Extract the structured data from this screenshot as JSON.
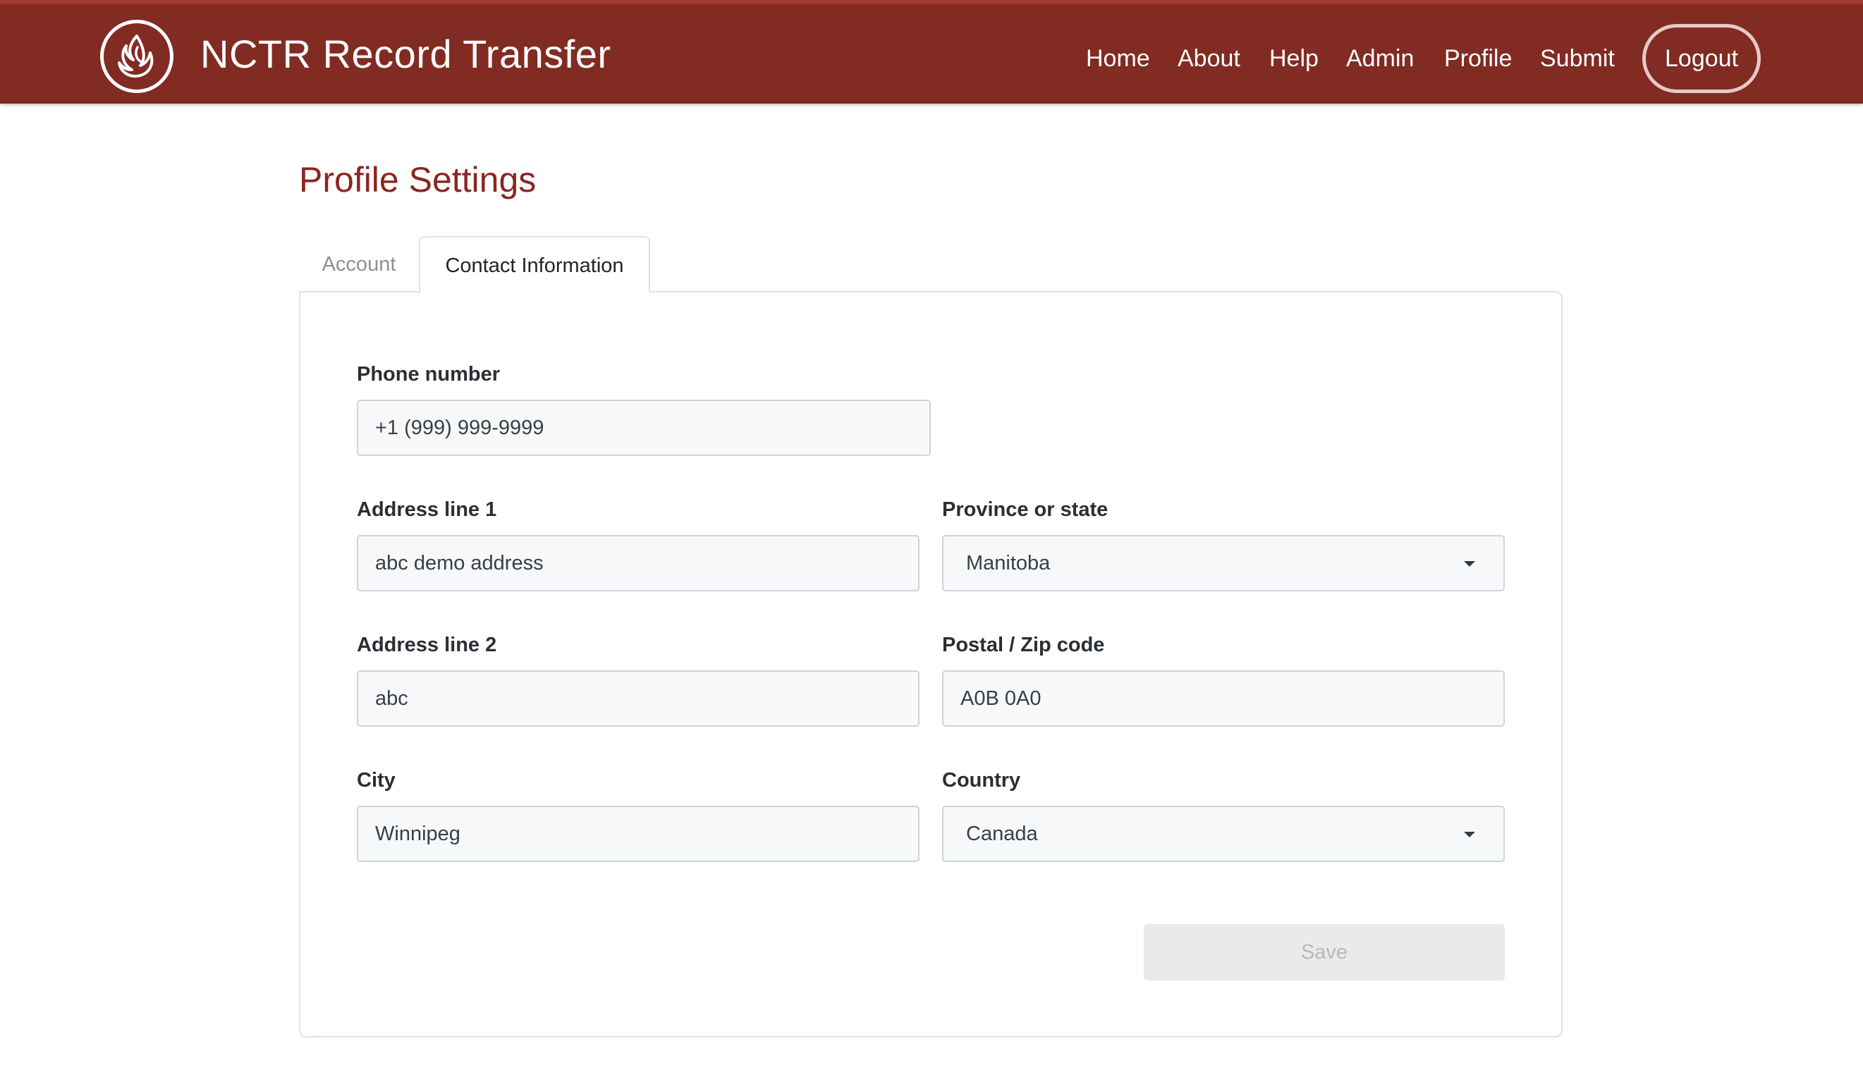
{
  "header": {
    "title": "NCTR Record Transfer",
    "logo_icon": "flame-feather-logo-icon",
    "background_color": "#812b23",
    "nav": {
      "home": "Home",
      "about": "About",
      "help": "Help",
      "admin": "Admin",
      "profile": "Profile",
      "submit": "Submit",
      "logout": "Logout"
    }
  },
  "page": {
    "title": "Profile Settings",
    "title_color": "#8b2520"
  },
  "tabs": {
    "account": "Account",
    "contact": "Contact Information",
    "active": "Contact Information"
  },
  "form": {
    "phone": {
      "label": "Phone number",
      "value": "+1 (999) 999-9999"
    },
    "address1": {
      "label": "Address line 1",
      "value": "abc demo address"
    },
    "province": {
      "label": "Province or state",
      "value": "Manitoba"
    },
    "address2": {
      "label": "Address line 2",
      "value": "abc"
    },
    "postal": {
      "label": "Postal / Zip code",
      "value": "A0B 0A0"
    },
    "city": {
      "label": "City",
      "value": "Winnipeg"
    },
    "country": {
      "label": "Country",
      "value": "Canada"
    },
    "save_label": "Save",
    "save_disabled": true
  }
}
